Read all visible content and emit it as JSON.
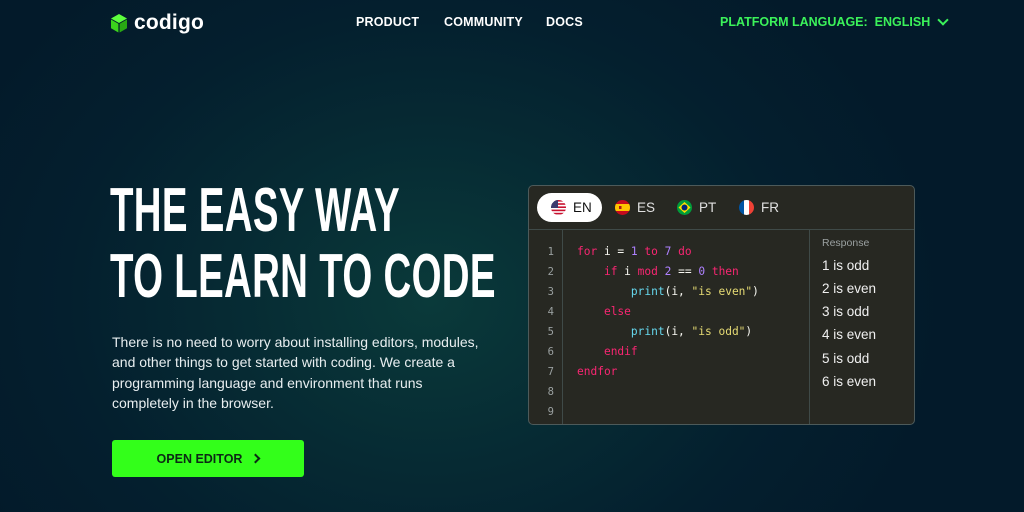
{
  "brand": {
    "name": "codigo",
    "accent": "#33ff1a"
  },
  "nav": {
    "items": [
      "PRODUCT",
      "COMMUNITY",
      "DOCS"
    ]
  },
  "language": {
    "label": "PLATFORM LANGUAGE:",
    "value": "ENGLISH"
  },
  "hero": {
    "title_line1": "THE EASY WAY",
    "title_line2": "TO LEARN TO CODE",
    "description": "There is no need to worry about installing editors, modules, and other things to get started with coding. We create a programming language and environment that runs completely in the browser.",
    "cta": "OPEN EDITOR"
  },
  "editor": {
    "tabs": [
      {
        "code": "EN",
        "flag": "us-flag-icon",
        "active": true
      },
      {
        "code": "ES",
        "flag": "spain-flag-icon",
        "active": false
      },
      {
        "code": "PT",
        "flag": "brazil-flag-icon",
        "active": false
      },
      {
        "code": "FR",
        "flag": "france-flag-icon",
        "active": false
      }
    ],
    "line_numbers": [
      "1",
      "2",
      "3",
      "4",
      "5",
      "6",
      "7",
      "8",
      "9"
    ],
    "code_lines": [
      "for i = 1 to 7 do",
      "    if i mod 2 == 0 then",
      "        print(i, \"is even\")",
      "    else",
      "        print(i, \"is odd\")",
      "    endif",
      "endfor",
      "",
      ""
    ],
    "response_title": "Response",
    "response": [
      "1 is odd",
      "2 is even",
      "3 is odd",
      "4 is even",
      "5 is odd",
      "6 is even"
    ]
  }
}
